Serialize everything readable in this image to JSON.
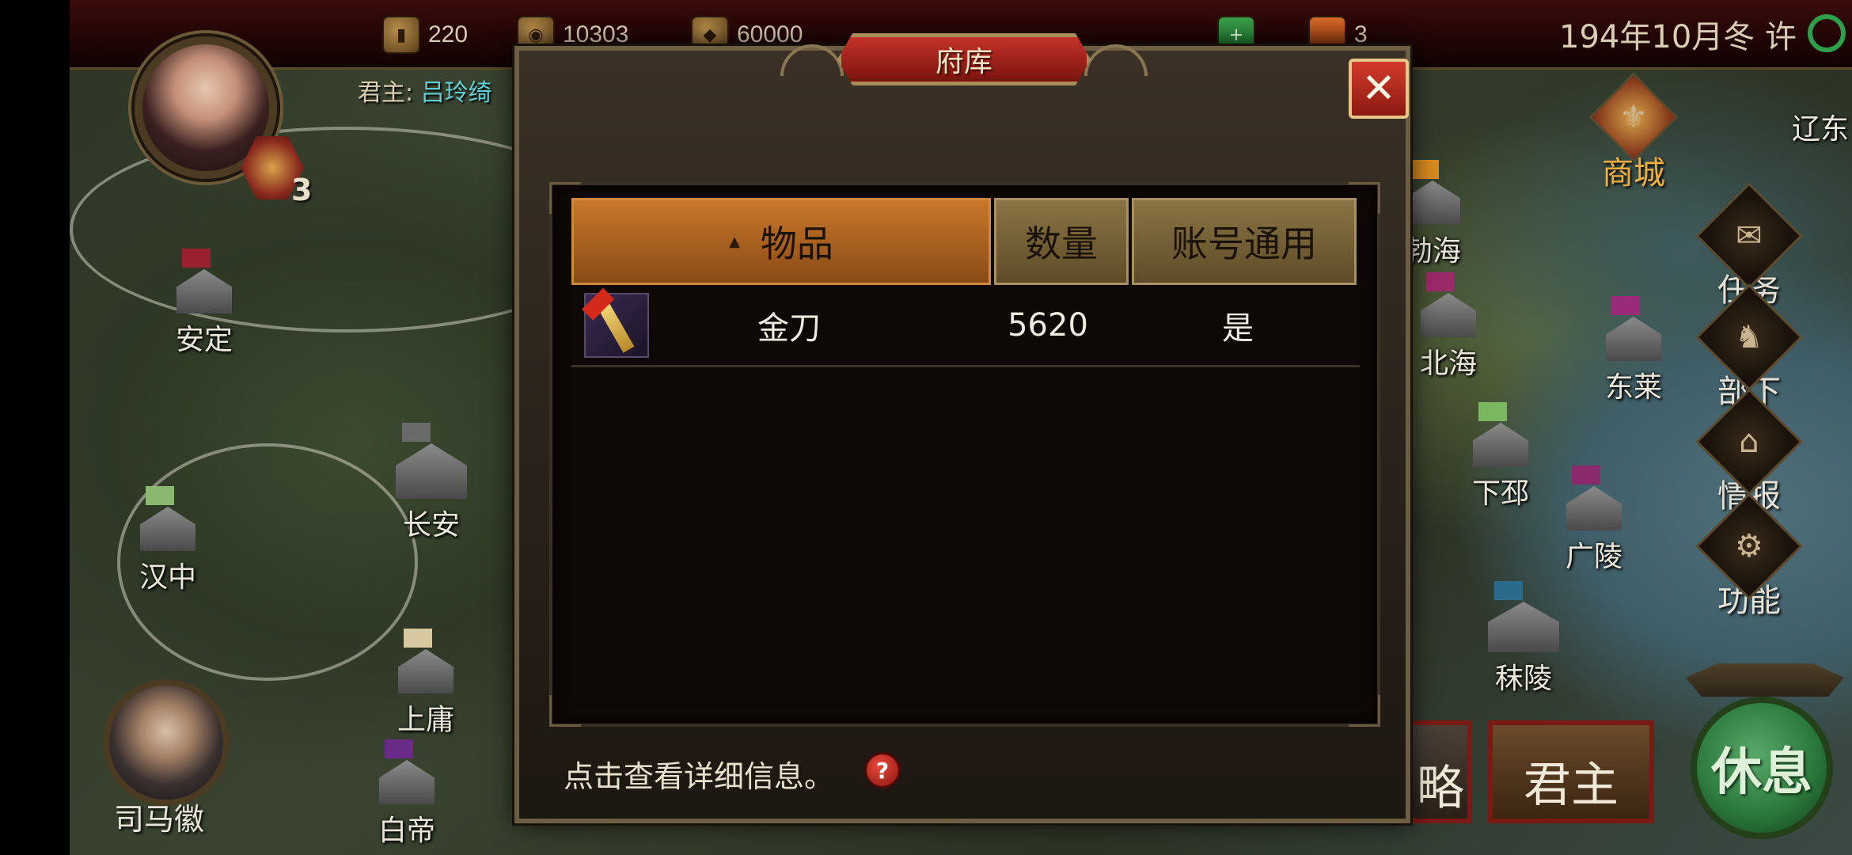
{
  "resources": [
    {
      "icon": "wood-icon",
      "glyph": "▮",
      "value": "220"
    },
    {
      "icon": "grain-icon",
      "glyph": "◉",
      "value": "10303"
    },
    {
      "icon": "silver-icon",
      "glyph": "◆",
      "value": "60000"
    }
  ],
  "resource_extra": {
    "value": "3"
  },
  "date_text": "194年10月冬 许",
  "lord": {
    "label": "君主: ",
    "name": "吕玲绮",
    "count": "3"
  },
  "cities": [
    {
      "name": "安定",
      "flag": "#9a2030"
    },
    {
      "name": "长安",
      "flag": "#6a6a6a"
    },
    {
      "name": "汉中",
      "flag": "#8ab870"
    },
    {
      "name": "上庸",
      "flag": "#d8c8a0"
    },
    {
      "name": "白帝",
      "flag": "#6a2a8a"
    },
    {
      "name": "勃海",
      "flag": "#d88a20"
    },
    {
      "name": "北海",
      "flag": "#9a2a6a"
    },
    {
      "name": "东莱",
      "flag": "#9a2a7a"
    },
    {
      "name": "下邳",
      "flag": "#7ab860"
    },
    {
      "name": "广陵",
      "flag": "#8a2a6a"
    },
    {
      "name": "秣陵",
      "flag": "#2a6a8a"
    },
    {
      "name": "辽东",
      "flag": "#6a6a6a"
    }
  ],
  "shop": {
    "label": "商城"
  },
  "side_menu": [
    {
      "label": "任务",
      "icon": "scroll-icon",
      "glyph": "✉"
    },
    {
      "label": "部下",
      "icon": "general-icon",
      "glyph": "♞"
    },
    {
      "label": "情报",
      "icon": "intel-icon",
      "glyph": "⌂"
    },
    {
      "label": "功能",
      "icon": "gear-icon",
      "glyph": "⚙"
    }
  ],
  "advisor": {
    "name": "司马徽"
  },
  "bottom": {
    "strategy_partial": "略",
    "lord_label": "君主",
    "rest_label": "休息"
  },
  "dialog": {
    "title": "府库",
    "close_glyph": "✕",
    "columns": {
      "sort_glyph": "▲",
      "item": "物品",
      "qty": "数量",
      "shared": "账号通用"
    },
    "rows": [
      {
        "name": "金刀",
        "qty": "5620",
        "shared": "是"
      }
    ],
    "hint": "点击查看详细信息。",
    "help_glyph": "?"
  }
}
